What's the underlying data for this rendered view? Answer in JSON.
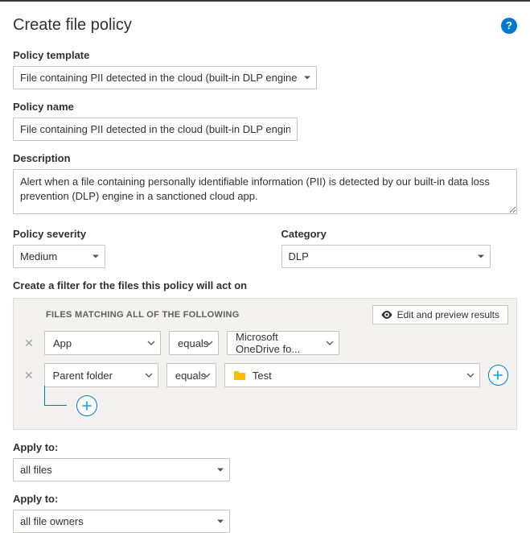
{
  "header": {
    "title": "Create file policy",
    "help_glyph": "?"
  },
  "template": {
    "label": "Policy template",
    "value": "File containing PII detected in the cloud (built-in DLP engine)"
  },
  "name": {
    "label": "Policy name",
    "value": "File containing PII detected in the cloud (built-in DLP engine)"
  },
  "description": {
    "label": "Description",
    "value": "Alert when a file containing personally identifiable information (PII) is detected by our built-in data loss prevention (DLP) engine in a sanctioned cloud app."
  },
  "severity": {
    "label": "Policy severity",
    "value": "Medium"
  },
  "category": {
    "label": "Category",
    "value": "DLP"
  },
  "filter": {
    "title": "Create a filter for the files this policy will act on",
    "matching_label": "FILES MATCHING ALL OF THE FOLLOWING",
    "preview_label": "Edit and preview results",
    "rows": [
      {
        "field": "App",
        "op": "equals",
        "value": "Microsoft OneDrive fo..."
      },
      {
        "field": "Parent folder",
        "op": "equals",
        "value": "Test",
        "is_folder": true
      }
    ]
  },
  "apply_files": {
    "label": "Apply to:",
    "value": "all files"
  },
  "apply_owners": {
    "label": "Apply to:",
    "value": "all file owners"
  }
}
